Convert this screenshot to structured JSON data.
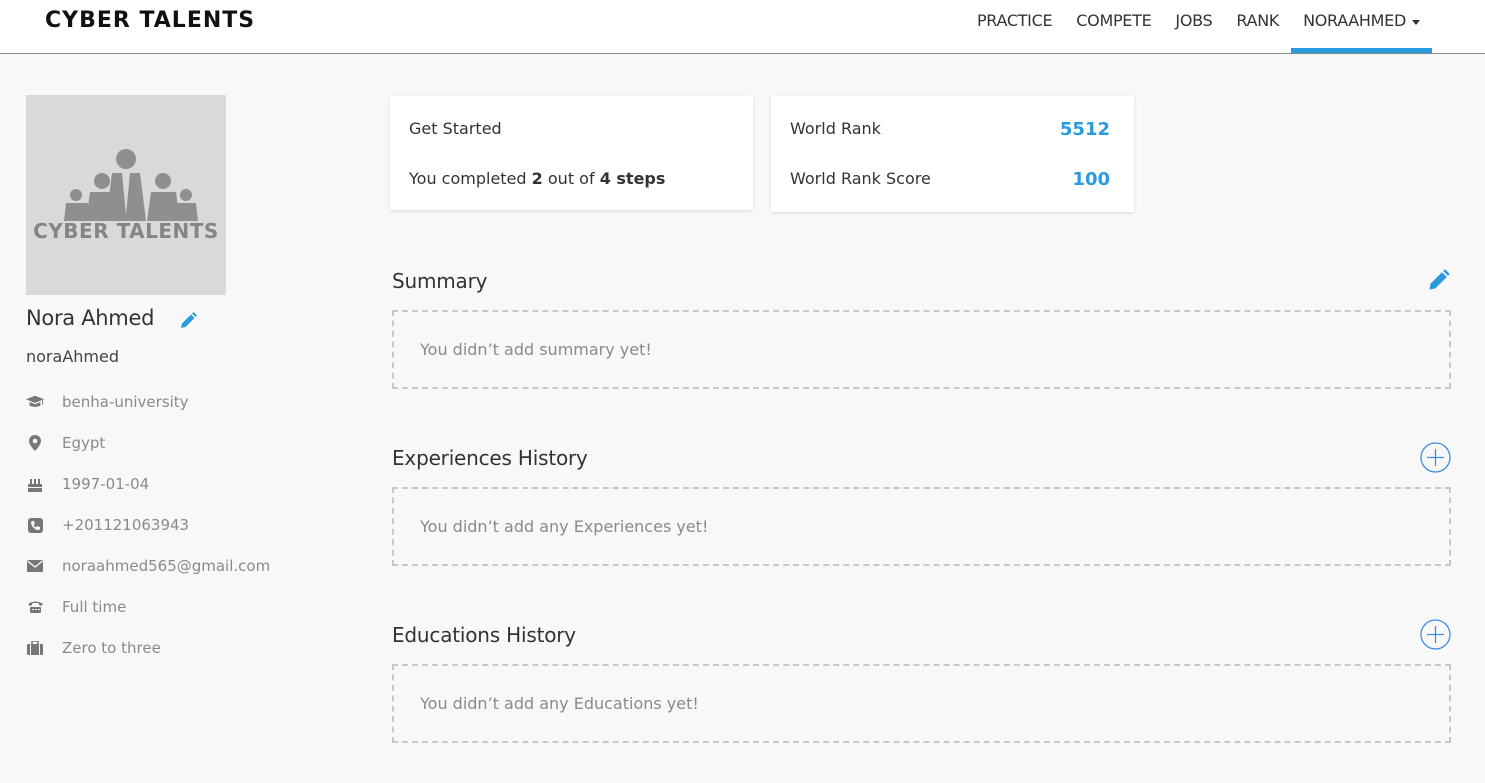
{
  "brand": "CYBER TALENTS",
  "nav": {
    "items": [
      "PRACTICE",
      "COMPETE",
      "JOBS",
      "RANK"
    ],
    "user_menu": "NORAAHMED",
    "accent_color": "#2b9be0"
  },
  "profile": {
    "avatar_text": "CYBER TALENTS",
    "name": "Nora Ahmed",
    "username": "noraAhmed",
    "details": [
      {
        "icon": "graduation-cap-icon",
        "text": "benha-university"
      },
      {
        "icon": "map-marker-icon",
        "text": "Egypt"
      },
      {
        "icon": "birthday-cake-icon",
        "text": "1997-01-04"
      },
      {
        "icon": "phone-icon",
        "text": "+201121063943"
      },
      {
        "icon": "envelope-icon",
        "text": "noraahmed565@gmail.com"
      },
      {
        "icon": "work-type-icon",
        "text": "Full time"
      },
      {
        "icon": "briefcase-icon",
        "text": "Zero to three"
      }
    ]
  },
  "get_started": {
    "title": "Get Started",
    "text_prefix": "You completed",
    "completed": "2",
    "text_mid": "out of",
    "total": "4 steps"
  },
  "rank": {
    "world_rank_label": "World Rank",
    "world_rank_value": "5512",
    "world_rank_score_label": "World Rank Score",
    "world_rank_score_value": "100"
  },
  "sections": {
    "summary": {
      "title": "Summary",
      "empty": "You didn’t add summary yet!"
    },
    "experiences": {
      "title": "Experiences History",
      "empty": "You didn’t add any Experiences yet!"
    },
    "educations": {
      "title": "Educations History",
      "empty": "You didn’t add any Educations yet!"
    }
  }
}
